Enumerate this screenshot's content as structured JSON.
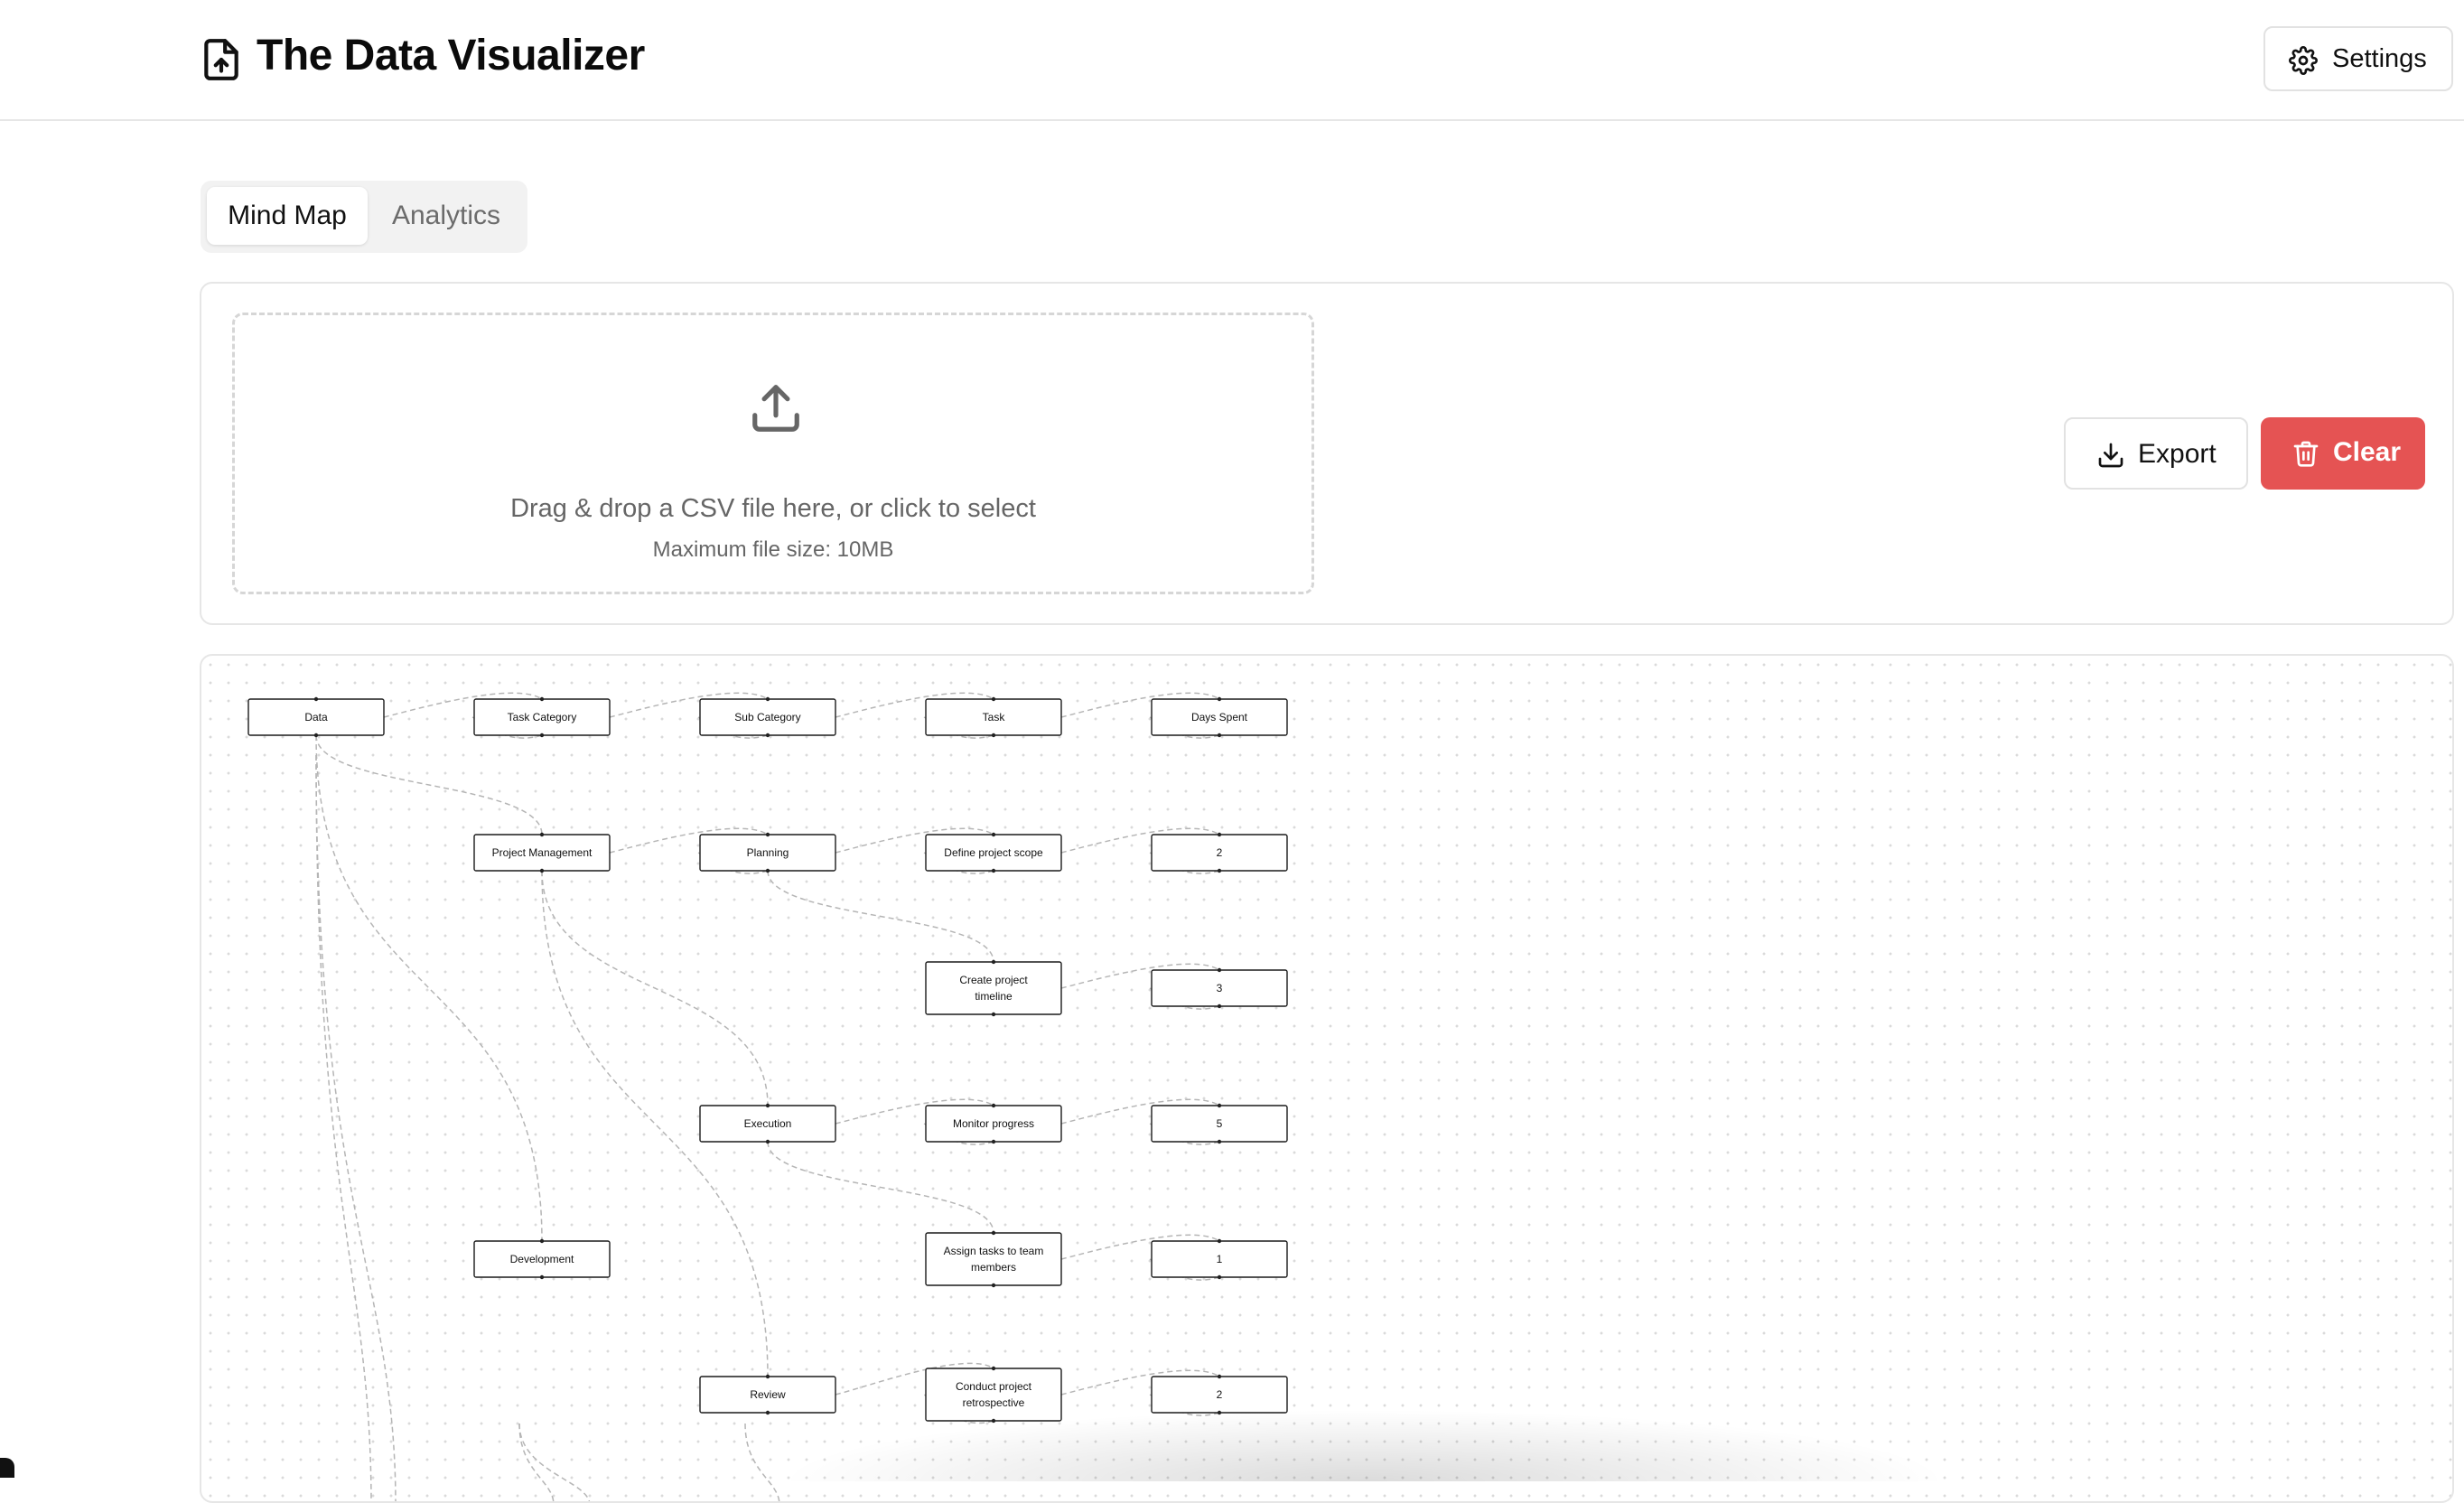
{
  "app": {
    "title": "The Data Visualizer"
  },
  "header": {
    "settings_label": "Settings"
  },
  "tabs": [
    {
      "label": "Mind Map",
      "active": true
    },
    {
      "label": "Analytics",
      "active": false
    }
  ],
  "upload": {
    "prompt": "Drag & drop a CSV file here, or click to select",
    "limit": "Maximum file size: 10MB"
  },
  "actions": {
    "export_label": "Export",
    "clear_label": "Clear"
  },
  "colors": {
    "danger": "#e55353",
    "border": "#e6e6e6"
  },
  "mindmap": {
    "nodes": [
      {
        "id": "data",
        "lines": [
          "Data"
        ]
      },
      {
        "id": "task-category",
        "lines": [
          "Task Category"
        ]
      },
      {
        "id": "sub-category",
        "lines": [
          "Sub Category"
        ]
      },
      {
        "id": "task",
        "lines": [
          "Task"
        ]
      },
      {
        "id": "days-spent",
        "lines": [
          "Days Spent"
        ]
      },
      {
        "id": "project-management",
        "lines": [
          "Project Management"
        ]
      },
      {
        "id": "planning",
        "lines": [
          "Planning"
        ]
      },
      {
        "id": "define-scope",
        "lines": [
          "Define project scope"
        ]
      },
      {
        "id": "val-2a",
        "lines": [
          "2"
        ]
      },
      {
        "id": "create-timeline",
        "lines": [
          "Create project",
          "timeline"
        ]
      },
      {
        "id": "val-3",
        "lines": [
          "3"
        ]
      },
      {
        "id": "execution",
        "lines": [
          "Execution"
        ]
      },
      {
        "id": "monitor-progress",
        "lines": [
          "Monitor progress"
        ]
      },
      {
        "id": "val-5",
        "lines": [
          "5"
        ]
      },
      {
        "id": "development",
        "lines": [
          "Development"
        ]
      },
      {
        "id": "assign-tasks",
        "lines": [
          "Assign tasks to team",
          "members"
        ]
      },
      {
        "id": "val-1",
        "lines": [
          "1"
        ]
      },
      {
        "id": "review",
        "lines": [
          "Review"
        ]
      },
      {
        "id": "retrospective",
        "lines": [
          "Conduct project",
          "retrospective"
        ]
      },
      {
        "id": "val-2b",
        "lines": [
          "2"
        ]
      }
    ],
    "edges": [
      [
        "data",
        "task-category"
      ],
      [
        "task-category",
        "sub-category"
      ],
      [
        "sub-category",
        "task"
      ],
      [
        "task",
        "days-spent"
      ],
      [
        "data",
        "project-management"
      ],
      [
        "project-management",
        "planning"
      ],
      [
        "planning",
        "define-scope"
      ],
      [
        "define-scope",
        "val-2a"
      ],
      [
        "planning",
        "create-timeline"
      ],
      [
        "create-timeline",
        "val-3"
      ],
      [
        "project-management",
        "execution"
      ],
      [
        "execution",
        "monitor-progress"
      ],
      [
        "monitor-progress",
        "val-5"
      ],
      [
        "execution",
        "assign-tasks"
      ],
      [
        "assign-tasks",
        "val-1"
      ],
      [
        "data",
        "development"
      ],
      [
        "project-management",
        "review"
      ],
      [
        "review",
        "retrospective"
      ],
      [
        "retrospective",
        "val-2b"
      ]
    ]
  }
}
